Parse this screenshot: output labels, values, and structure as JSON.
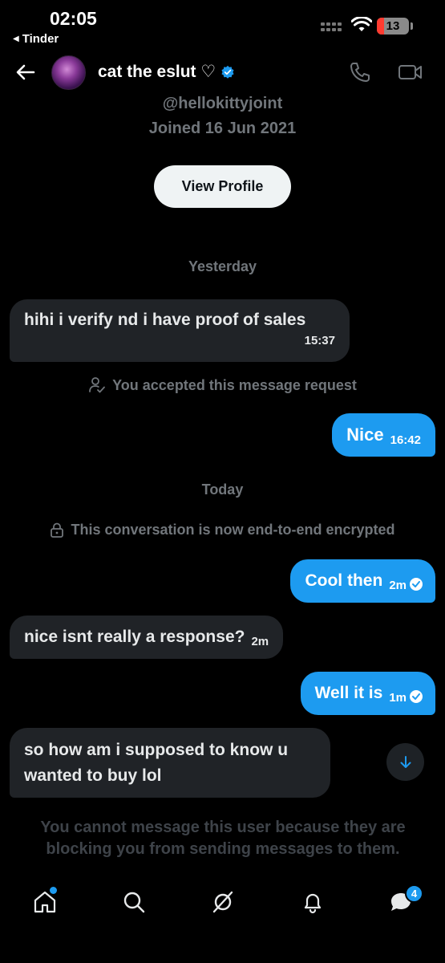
{
  "status_bar": {
    "time": "02:05",
    "back_app": "Tinder",
    "battery": "13"
  },
  "header": {
    "contact_name": "cat the eslut ♡",
    "handle": "@hellokittyjoint",
    "joined": "Joined 16 Jun 2021",
    "view_profile": "View Profile"
  },
  "conversation": {
    "yesterday_label": "Yesterday",
    "today_label": "Today",
    "messages": [
      {
        "text": "hihi i verify nd i have proof of sales",
        "time": "15:37",
        "direction": "incoming"
      },
      {
        "text": "Nice",
        "time": "16:42",
        "direction": "outgoing"
      },
      {
        "text": "Cool then",
        "time": "2m",
        "direction": "outgoing",
        "read": true
      },
      {
        "text": "nice isnt really a response?",
        "time": "2m",
        "direction": "incoming"
      },
      {
        "text": "Well it is",
        "time": "1m",
        "direction": "outgoing",
        "read": true
      },
      {
        "text": "so how am i supposed to know u wanted to buy lol",
        "time": "",
        "direction": "incoming"
      }
    ],
    "accepted_notice": "You accepted this message request",
    "encrypted_notice": "This conversation is now end-to-end encrypted",
    "blocked_notice": "You cannot message this user because they are blocking you from sending messages to them."
  },
  "tab_bar": {
    "items": [
      "home-icon",
      "search-icon",
      "grok-icon",
      "notifications-icon",
      "messages-icon"
    ],
    "messages_badge": "4"
  },
  "colors": {
    "accent": "#1d9bf0",
    "incoming_bubble": "#202327",
    "muted_text": "#71767b"
  }
}
